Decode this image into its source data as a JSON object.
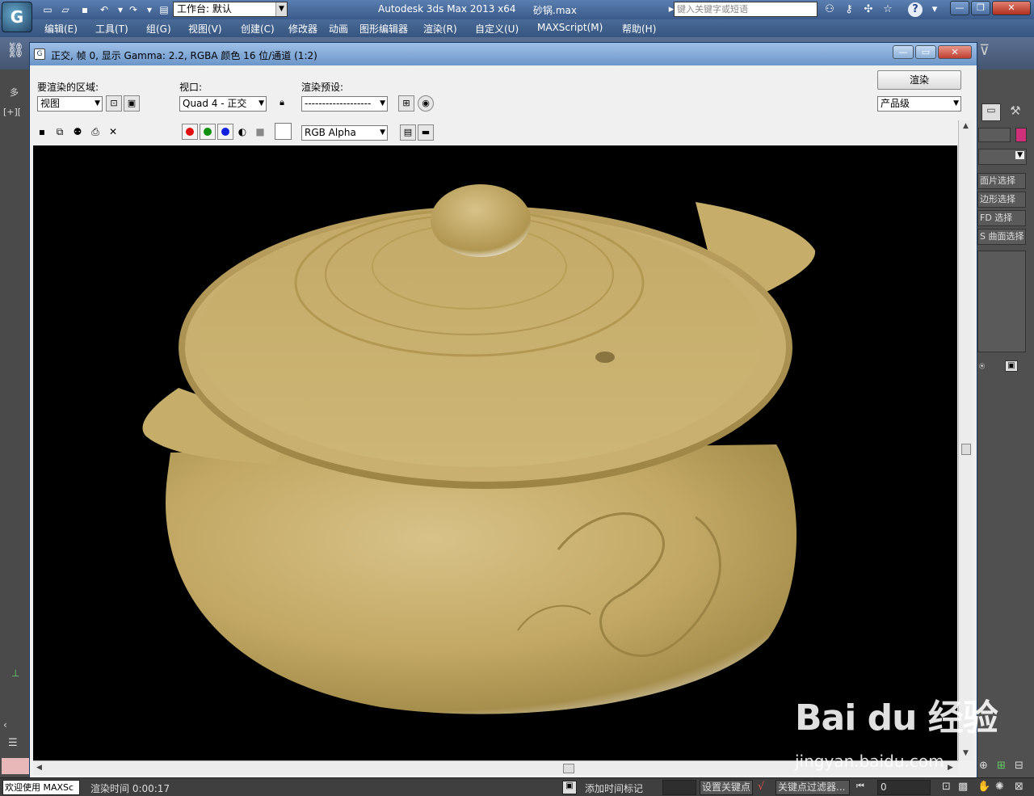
{
  "app": {
    "title": "Autodesk 3ds Max  2013 x64",
    "file_name": "砂锅.max",
    "logo_letter": "G",
    "workspace_label": "工作台: 默认",
    "search_placeholder": "键入关键字或短语",
    "help_icon": "?"
  },
  "menu": {
    "items": [
      "编辑(E)",
      "工具(T)",
      "组(G)",
      "视图(V)",
      "创建(C)",
      "修改器",
      "动画",
      "图形编辑器",
      "渲染(R)",
      "自定义(U)",
      "MAXScript(M)",
      "帮助(H)"
    ]
  },
  "render_window": {
    "title": "正交, 帧 0, 显示 Gamma: 2.2, RGBA 颜色 16 位/通道 (1:2)",
    "area_label": "要渲染的区域:",
    "area_value": "视图",
    "viewport_label": "视口:",
    "viewport_value": "Quad 4 - 正交",
    "preset_label": "渲染预设:",
    "preset_value": "-------------------",
    "render_button": "渲染",
    "quality_value": "产品级",
    "channel_value": "RGB Alpha"
  },
  "left_viewport_label": "[+][",
  "left_tab_label": "多",
  "right_panel": {
    "items": [
      "面片选择",
      "边形选择",
      "FD 选择",
      "S 曲面选择"
    ]
  },
  "status": {
    "welcome": "欢迎使用 MAXSc",
    "render_time": "渲染时间 0:00:17",
    "add_time_tag": "添加时间标记",
    "set_key": "设置关键点",
    "key_filter": "关键点过滤器...",
    "frame": "0"
  },
  "watermark": {
    "logo": "Bai du 经验",
    "url": "jingyan.baidu.com"
  },
  "colors": {
    "pot": "#c8b06a",
    "canvas_bg": "#000000",
    "title_bar": "#4a6a98"
  }
}
